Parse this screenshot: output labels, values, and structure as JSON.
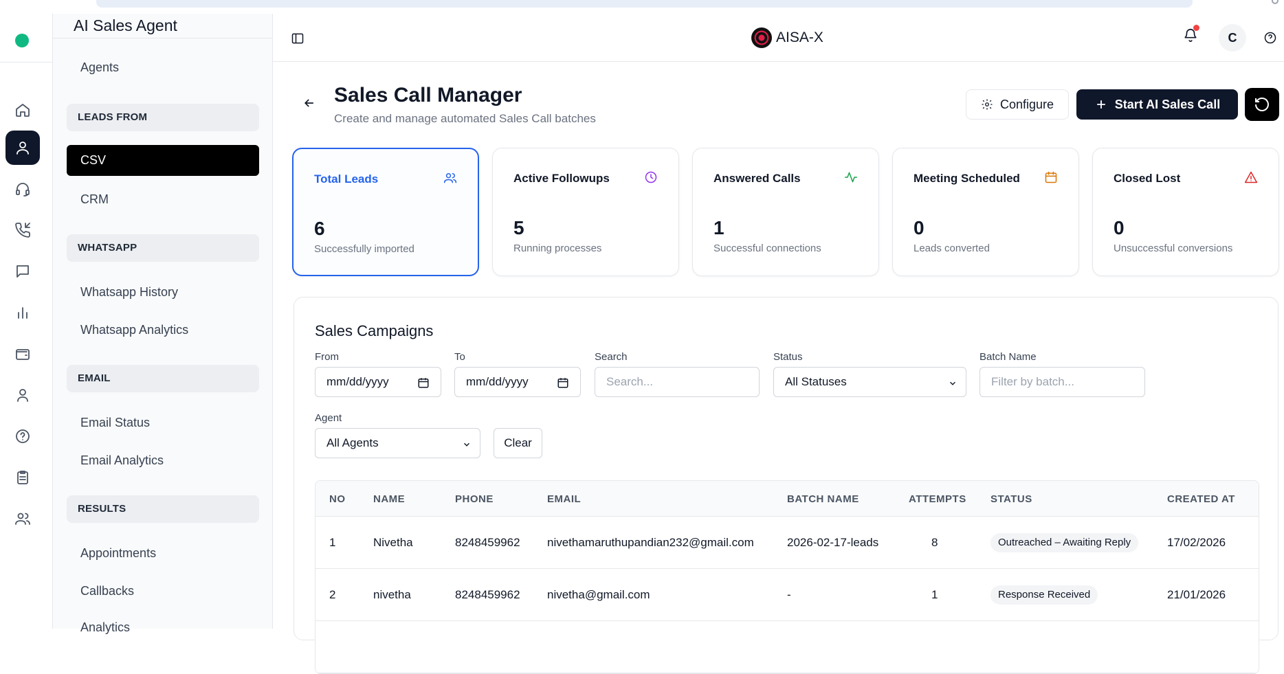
{
  "app": {
    "brand": "AI Sales Agent",
    "logo_text": "AISA-X",
    "avatar_initial": "C"
  },
  "sidebar": {
    "agents_label": "Agents",
    "sections": {
      "leads_from": "LEADS FROM",
      "whatsapp": "WHATSAPP",
      "email": "EMAIL",
      "results": "RESULTS"
    },
    "items": {
      "csv": "CSV",
      "crm": "CRM",
      "whatsapp_history": "Whatsapp History",
      "whatsapp_analytics": "Whatsapp Analytics",
      "email_status": "Email Status",
      "email_analytics": "Email Analytics",
      "appointments": "Appointments",
      "callbacks": "Callbacks",
      "analytics": "Analytics"
    }
  },
  "rail_icons": [
    "home-icon",
    "user-icon",
    "headset-icon",
    "phone-incoming-icon",
    "message-icon",
    "bar-chart-icon",
    "wallet-icon",
    "profile-icon",
    "help-circle-icon",
    "clipboard-icon",
    "users-icon"
  ],
  "page": {
    "title": "Sales Call Manager",
    "subtitle": "Create and manage automated Sales Call batches",
    "configure_label": "Configure",
    "start_label": "Start AI Sales Call"
  },
  "stats": [
    {
      "label": "Total Leads",
      "value": "6",
      "hint": "Successfully imported",
      "color": "#2563eb"
    },
    {
      "label": "Active Followups",
      "value": "5",
      "hint": "Running processes",
      "color": "#9333ea"
    },
    {
      "label": "Answered Calls",
      "value": "1",
      "hint": "Successful connections",
      "color": "#16a34a"
    },
    {
      "label": "Meeting Scheduled",
      "value": "0",
      "hint": "Leads converted",
      "color": "#d97706"
    },
    {
      "label": "Closed Lost",
      "value": "0",
      "hint": "Unsuccessful conversions",
      "color": "#dc2626"
    }
  ],
  "campaigns": {
    "title": "Sales Campaigns",
    "filters": {
      "from_label": "From",
      "from_value": "mm/dd/yyyy",
      "to_label": "To",
      "to_value": "mm/dd/yyyy",
      "search_label": "Search",
      "search_placeholder": "Search...",
      "status_label": "Status",
      "status_value": "All Statuses",
      "batch_label": "Batch Name",
      "batch_placeholder": "Filter by batch...",
      "agent_label": "Agent",
      "agent_value": "All Agents",
      "clear_label": "Clear"
    },
    "columns": [
      "NO",
      "NAME",
      "PHONE",
      "EMAIL",
      "BATCH NAME",
      "ATTEMPTS",
      "STATUS",
      "CREATED AT"
    ],
    "rows": [
      {
        "no": "1",
        "name": "Nivetha",
        "phone": "8248459962",
        "email": "nivethamaruthupandian232@gmail.com",
        "batch": "2026-02-17-leads",
        "attempts": "8",
        "status": "Outreached – Awaiting Reply",
        "created": "17/02/2026"
      },
      {
        "no": "2",
        "name": "nivetha",
        "phone": "8248459962",
        "email": "nivetha@gmail.com",
        "batch": "-",
        "attempts": "1",
        "status": "Response Received",
        "created": "21/01/2026"
      }
    ]
  }
}
